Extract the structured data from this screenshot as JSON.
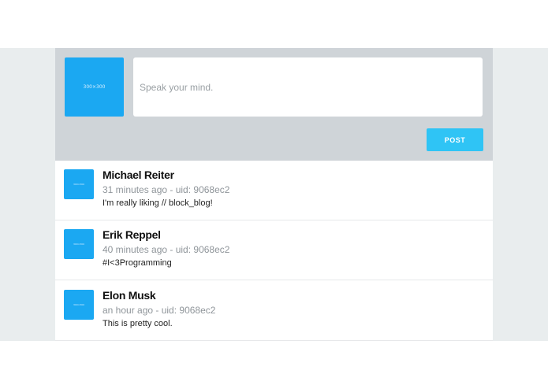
{
  "composer": {
    "avatar_label": "300×300",
    "placeholder": "Speak your mind.",
    "post_label": "POST"
  },
  "posts": [
    {
      "avatar_label": "300×300",
      "author": "Michael Reiter",
      "meta": "31 minutes ago - uid: 9068ec2",
      "body": "I'm really liking // block_blog!"
    },
    {
      "avatar_label": "300×300",
      "author": "Erik Reppel",
      "meta": "40 minutes ago - uid: 9068ec2",
      "body": "#I<3Programming"
    },
    {
      "avatar_label": "300×300",
      "author": "Elon Musk",
      "meta": "an hour ago - uid: 9068ec2",
      "body": "This is pretty cool."
    }
  ],
  "colors": {
    "accent": "#2fc4f5",
    "avatar": "#1ba8f2",
    "composer_bg": "#cfd4d8",
    "page_bg": "#e9edee"
  }
}
